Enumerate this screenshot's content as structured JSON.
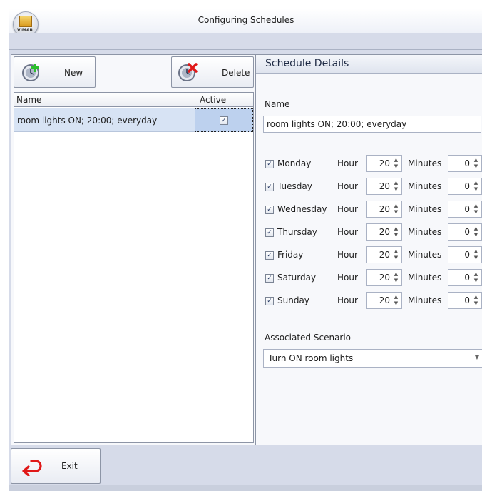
{
  "window": {
    "title": "Configuring Schedules",
    "logo_text": "VIMAR"
  },
  "toolbar": {
    "new_label": "New",
    "delete_label": "Delete"
  },
  "grid": {
    "columns": [
      "Name",
      "Active"
    ],
    "rows": [
      {
        "name": "room lights ON; 20:00; everyday",
        "active": true
      }
    ]
  },
  "details": {
    "header": "Schedule Details",
    "name_label": "Name",
    "name_value": "room lights ON; 20:00; everyday",
    "hour_label": "Hour",
    "minutes_label": "Minutes",
    "days": [
      {
        "day": "Monday",
        "checked": true,
        "hour": "20",
        "minutes": "0"
      },
      {
        "day": "Tuesday",
        "checked": true,
        "hour": "20",
        "minutes": "0"
      },
      {
        "day": "Wednesday",
        "checked": true,
        "hour": "20",
        "minutes": "0"
      },
      {
        "day": "Thursday",
        "checked": true,
        "hour": "20",
        "minutes": "0"
      },
      {
        "day": "Friday",
        "checked": true,
        "hour": "20",
        "minutes": "0"
      },
      {
        "day": "Saturday",
        "checked": true,
        "hour": "20",
        "minutes": "0"
      },
      {
        "day": "Sunday",
        "checked": true,
        "hour": "20",
        "minutes": "0"
      }
    ],
    "scenario_label": "Associated Scenario",
    "scenario_value": "Turn ON room lights"
  },
  "footer": {
    "exit_label": "Exit"
  },
  "colors": {
    "accent": "#d6dbe9",
    "selection": "#d7e3f4",
    "new_plus": "#2bbf2b",
    "delete_x": "#e01818",
    "exit_arrow": "#e01818"
  },
  "icons": {
    "new": "clock-plus-icon",
    "delete": "clock-delete-icon",
    "exit": "exit-arrow-icon",
    "check": "checkmark-icon"
  }
}
